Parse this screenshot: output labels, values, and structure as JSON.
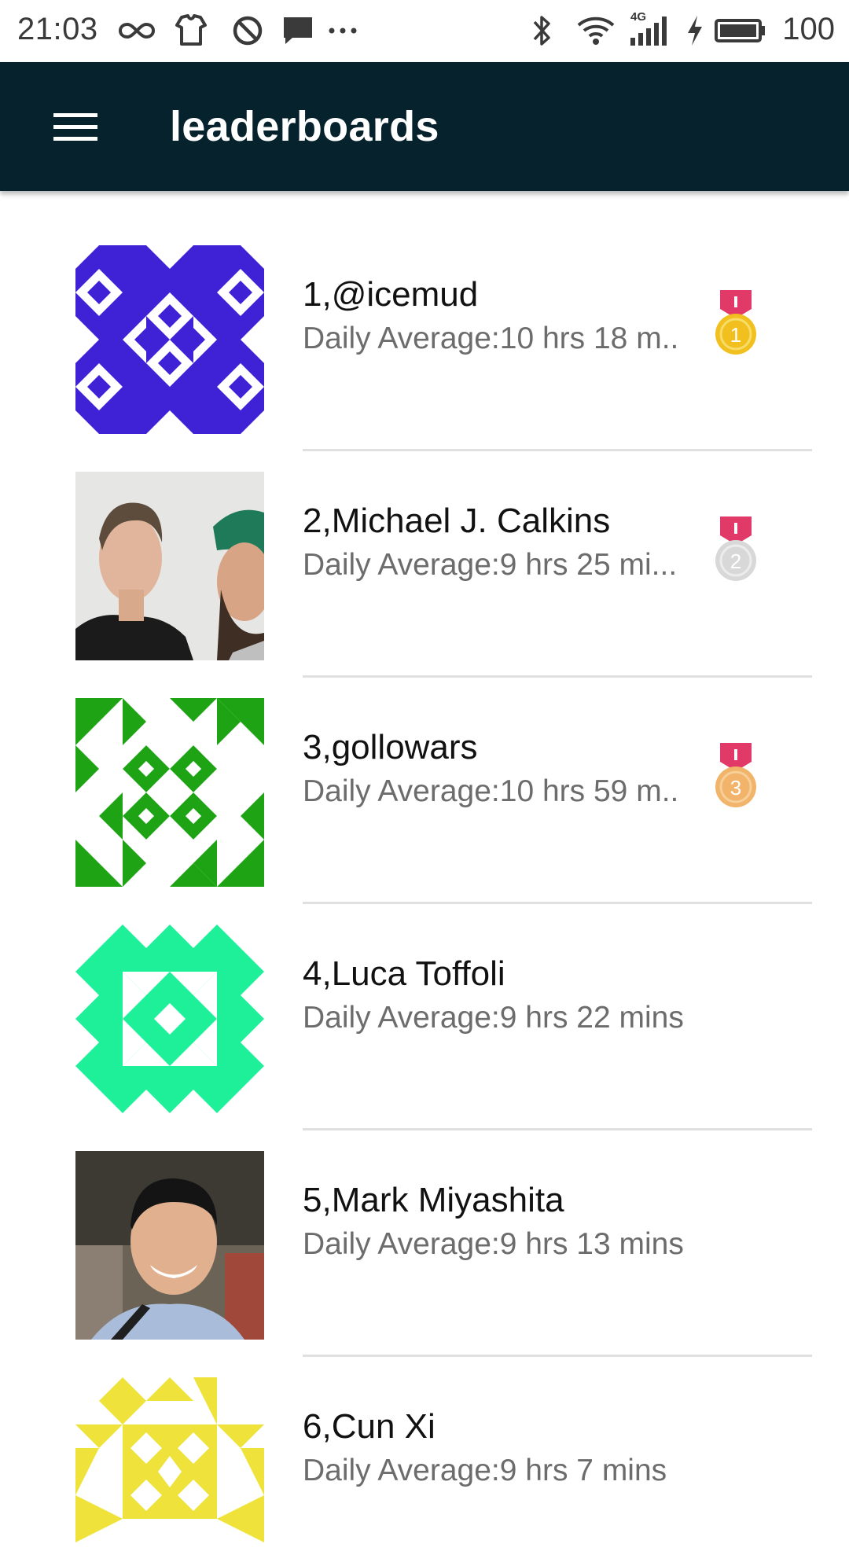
{
  "status_bar": {
    "time": "21:03",
    "network": "4G",
    "battery": "100",
    "icons": [
      "infinity-icon",
      "shirt-icon",
      "blocked-icon",
      "message-icon",
      "more-icon",
      "bluetooth-icon",
      "wifi-icon",
      "signal-icon",
      "charging-icon",
      "battery-icon"
    ]
  },
  "app_bar": {
    "title": "leaderboards",
    "menu_icon": "menu-icon",
    "background": "#06222d"
  },
  "leaderboard": [
    {
      "name": "1,@icemud",
      "daily": "Daily Average:10 hrs 18 m..",
      "medal": "1",
      "avatar": "identicon-blue"
    },
    {
      "name": "2,Michael J. Calkins",
      "daily": "Daily Average:9 hrs 25 mi...",
      "medal": "2",
      "avatar": "photo"
    },
    {
      "name": "3,gollowars",
      "daily": "Daily Average:10 hrs 59 m..",
      "medal": "3",
      "avatar": "identicon-green"
    },
    {
      "name": "4,Luca Toffoli",
      "daily": "Daily Average:9 hrs 22 mins",
      "medal": "",
      "avatar": "identicon-mint"
    },
    {
      "name": "5,Mark Miyashita",
      "daily": "Daily Average:9 hrs 13 mins",
      "medal": "",
      "avatar": "photo"
    },
    {
      "name": "6,Cun Xi",
      "daily": "Daily Average:9 hrs 7 mins",
      "medal": "",
      "avatar": "identicon-yellow"
    }
  ],
  "colors": {
    "medal_ribbon": "#e23a68",
    "gold": "#f2c01e",
    "silver": "#d8d8d8",
    "bronze": "#f1b46a",
    "identicon_blue": "#3f22d6",
    "identicon_green": "#1ea315",
    "identicon_mint": "#1ef09a",
    "identicon_yellow": "#efe33b"
  }
}
